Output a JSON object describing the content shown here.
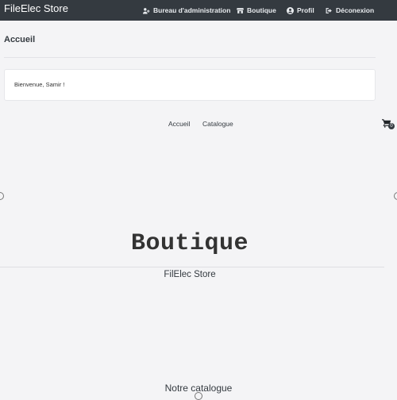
{
  "navbar": {
    "brand": "FileElec Store",
    "items": [
      {
        "label": "Bureau d'administration",
        "icon": "users-cog-icon"
      },
      {
        "label": "Boutique",
        "icon": "store-icon"
      },
      {
        "label": "Profil",
        "icon": "user-circle-icon"
      },
      {
        "label": "Déconexion",
        "icon": "sign-out-icon"
      }
    ]
  },
  "page": {
    "title": "Accueil",
    "welcome": "Bienvenue, Samir !"
  },
  "subnav": {
    "home": "Accueil",
    "catalog": "Catalogue"
  },
  "cart": {
    "count": "0",
    "icon": "shopping-cart-icon"
  },
  "hero": {
    "title": "Boutique",
    "subtitle": "FilElec Store"
  },
  "catalog": {
    "heading": "Notre catalogue"
  }
}
